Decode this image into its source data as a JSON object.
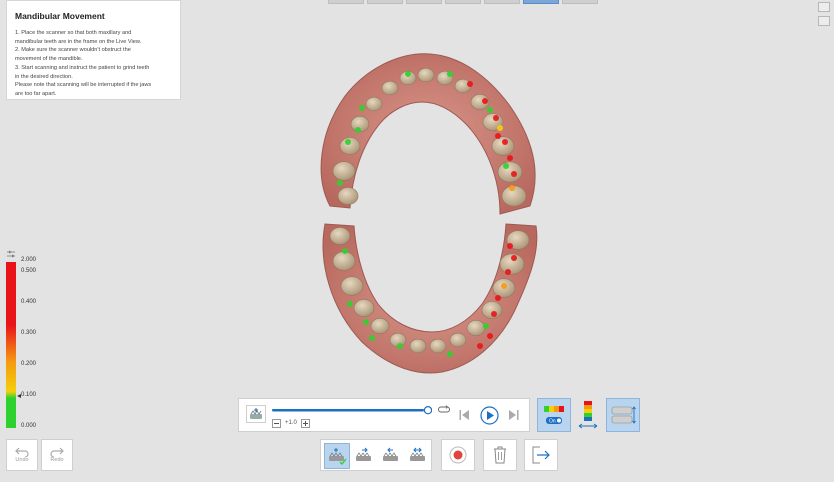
{
  "top_tabs": {
    "count": 7,
    "active_index": 5
  },
  "info_panel": {
    "title": "Mandibular Movement",
    "lines": [
      "1. Place the scanner so that both maxillary and",
      "mandibular teeth are in the frame on the Live View.",
      "2. Make sure the scanner wouldn't obstruct the",
      "movement of the mandible.",
      "3. Start scanning and instruct the patient to grind teeth",
      "in the desired direction.",
      "Please note that scanning will be interrupted if the jaws",
      "are too far apart."
    ]
  },
  "scale": {
    "labels": [
      "2.000",
      "0.500",
      "0.400",
      "0.300",
      "0.200",
      "0.100",
      "0.000"
    ],
    "colors": {
      "red": "#e8141a",
      "orange": "#f59a12",
      "yellow": "#f3cf0c",
      "green": "#2ed12e"
    }
  },
  "playback": {
    "progress": 1.0,
    "speed_label": "+1.0",
    "icons": {
      "minus": "minus-icon",
      "plus": "plus-icon",
      "loop": "loop-icon",
      "prev": "skip-previous-icon",
      "play": "play-icon",
      "next": "skip-next-icon"
    }
  },
  "side_buttons": {
    "on_badge": "On"
  },
  "toolbar": {
    "undo_label": "Undo",
    "redo_label": "Redo"
  },
  "colors": {
    "accent": "#1d6fc4",
    "record": "#e0443a",
    "selected_bg": "#b9d4ef"
  }
}
